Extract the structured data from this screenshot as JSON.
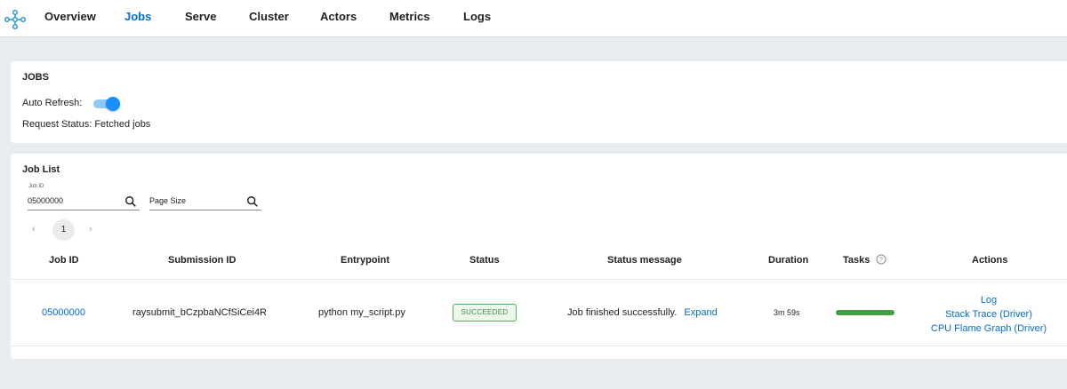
{
  "nav": {
    "items": [
      {
        "label": "Overview",
        "active": false
      },
      {
        "label": "Jobs",
        "active": true
      },
      {
        "label": "Serve",
        "active": false
      },
      {
        "label": "Cluster",
        "active": false
      },
      {
        "label": "Actors",
        "active": false
      },
      {
        "label": "Metrics",
        "active": false
      },
      {
        "label": "Logs",
        "active": false
      }
    ]
  },
  "jobs_card": {
    "title": "JOBS",
    "auto_refresh_label": "Auto Refresh:",
    "auto_refresh_on": true,
    "request_status": "Request Status: Fetched jobs"
  },
  "job_list": {
    "title": "Job List",
    "job_id_filter": {
      "label": "Job ID",
      "value": "05000000"
    },
    "page_size_filter": {
      "placeholder": "Page Size"
    },
    "pagination": {
      "current_page": "1",
      "prev_icon": "chevron-left-icon",
      "next_icon": "chevron-right-icon"
    },
    "columns": [
      "Job ID",
      "Submission ID",
      "Entrypoint",
      "Status",
      "Status message",
      "Duration",
      "Tasks",
      "Actions"
    ],
    "rows": [
      {
        "job_id": "05000000",
        "submission_id": "raysubmit_bCzpbaNCfSiCei4R",
        "entrypoint": "python my_script.py",
        "status": "SUCCEEDED",
        "status_message": "Job finished successfully.",
        "expand_label": "Expand",
        "duration": "3m 59s",
        "tasks_progress": 1.0,
        "actions": [
          "Log",
          "Stack Trace (Driver)",
          "CPU Flame Graph (Driver)"
        ]
      }
    ]
  },
  "colors": {
    "accent": "#036dcf",
    "success_border": "#4caf50",
    "success_text": "#3c8c40",
    "progress": "#43a047",
    "toggle": "#1890ff"
  }
}
